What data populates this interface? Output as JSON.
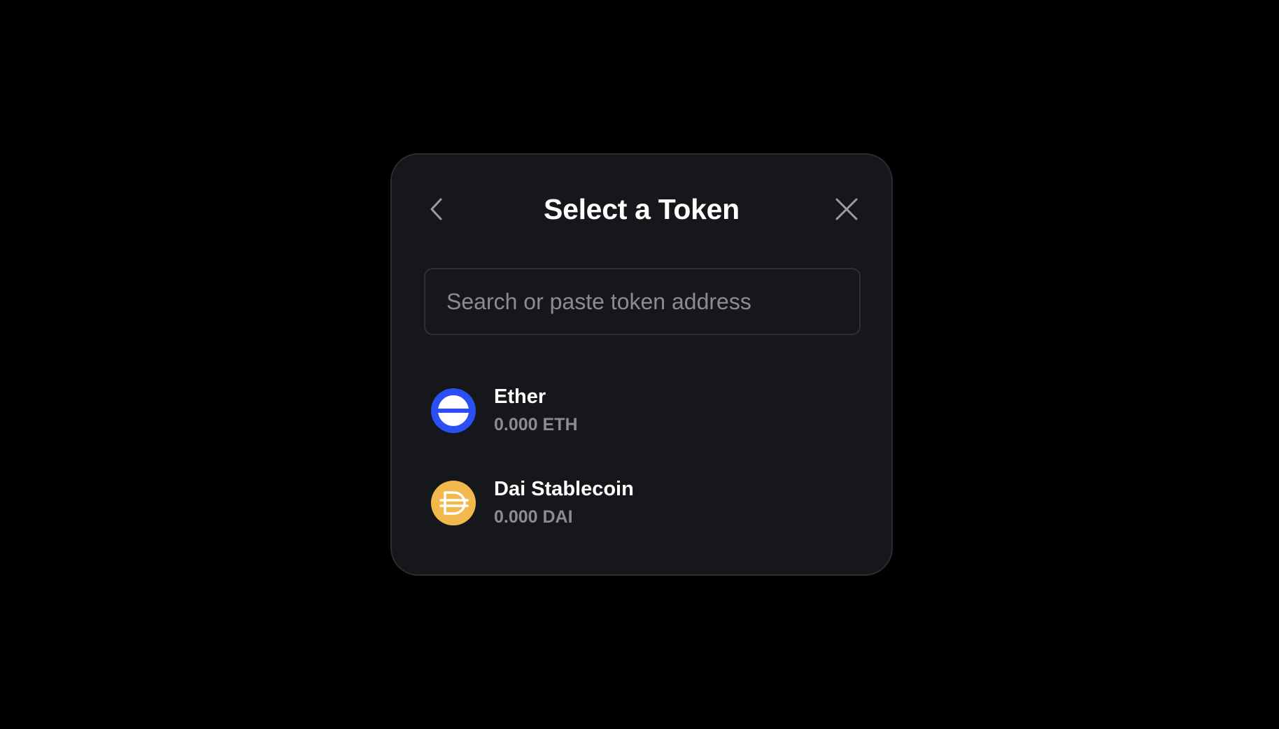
{
  "modal": {
    "title": "Select a Token"
  },
  "search": {
    "placeholder": "Search or paste token address",
    "value": ""
  },
  "icons": {
    "back": "chevron-left-icon",
    "close": "close-icon"
  },
  "tokens": [
    {
      "name": "Ether",
      "balance": "0.000 ETH",
      "icon": "ether-logo-icon",
      "color": "#2b4ff5"
    },
    {
      "name": "Dai Stablecoin",
      "balance": "0.000 DAI",
      "icon": "dai-logo-icon",
      "color": "#f2b84b"
    }
  ],
  "colors": {
    "background": "#000000",
    "modal_bg": "#15171b",
    "modal_border": "#2a2c31",
    "text_primary": "#ffffff",
    "text_secondary": "#8a8c91"
  }
}
